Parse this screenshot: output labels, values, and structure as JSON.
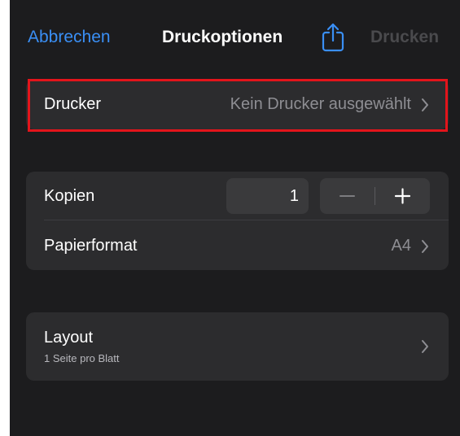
{
  "nav": {
    "cancel_label": "Abbrechen",
    "title": "Druckoptionen",
    "share_icon": "share-icon",
    "print_label": "Drucken"
  },
  "printer": {
    "label": "Drucker",
    "value": "Kein Drucker ausgewählt"
  },
  "copies": {
    "label": "Kopien",
    "value": "1",
    "decrement_icon": "minus-icon",
    "increment_icon": "plus-icon"
  },
  "paper": {
    "label": "Papierformat",
    "value": "A4"
  },
  "layout": {
    "label": "Layout",
    "subtitle": "1 Seite pro Blatt"
  },
  "colors": {
    "accent": "#3a8ff5",
    "background": "#1c1c1e",
    "group": "#2c2c2e",
    "highlight": "#e3141b",
    "disabled": "#4a4a4d"
  }
}
